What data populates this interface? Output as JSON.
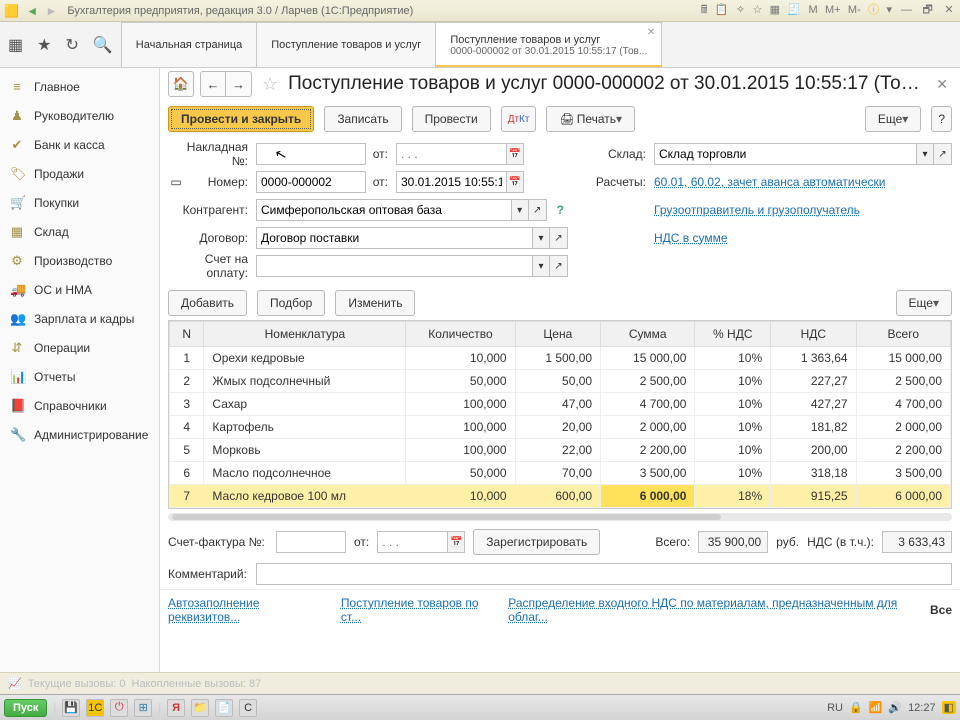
{
  "window": {
    "title": "Бухгалтерия предприятия, редакция 3.0 / Ларчев  (1С:Предприятие)"
  },
  "top_icons_right": [
    "📰",
    "⬚",
    "✧",
    "☆",
    "⊞",
    "⊡",
    "М",
    "М+",
    "М-",
    "ⓘ",
    "▾",
    "—",
    "🗗",
    "✕"
  ],
  "tabs": [
    {
      "l1": "Начальная страница"
    },
    {
      "l1": "Поступление товаров и услуг"
    },
    {
      "l1": "Поступление товаров и услуг",
      "l2": "0000-000002 от 30.01.2015 10:55:17 (Тов..."
    }
  ],
  "sidebar": [
    {
      "icon": "≡",
      "label": "Главное"
    },
    {
      "icon": "♟",
      "label": "Руководителю"
    },
    {
      "icon": "✔",
      "label": "Банк и касса"
    },
    {
      "icon": "🏷",
      "label": "Продажи"
    },
    {
      "icon": "🛒",
      "label": "Покупки"
    },
    {
      "icon": "▦",
      "label": "Склад"
    },
    {
      "icon": "⚙",
      "label": "Производство"
    },
    {
      "icon": "🚚",
      "label": "ОС и НМА"
    },
    {
      "icon": "👥",
      "label": "Зарплата и кадры"
    },
    {
      "icon": "⇵",
      "label": "Операции"
    },
    {
      "icon": "📊",
      "label": "Отчеты"
    },
    {
      "icon": "📕",
      "label": "Справочники"
    },
    {
      "icon": "🔧",
      "label": "Администрирование"
    }
  ],
  "doc": {
    "title": "Поступление товаров и услуг 0000-000002 от 30.01.2015 10:55:17 (Тов...",
    "btn_post_close": "Провести и закрыть",
    "btn_write": "Записать",
    "btn_post": "Провести",
    "btn_print": "Печать",
    "btn_more": "Еще",
    "labels": {
      "nakladnaya": "Накладная №:",
      "ot": "от:",
      "nomer": "Номер:",
      "kontragent": "Контрагент:",
      "dogovor": "Договор:",
      "schet_oplatu": "Счет на оплату:",
      "sklad": "Склад:",
      "raschety": "Расчеты:",
      "schet_faktura": "Счет-фактура №:",
      "kommentariy": "Комментарий:",
      "vsego": "Всего:",
      "rub": "руб.",
      "nds_vtch": "НДС (в т.ч.):"
    },
    "values": {
      "number": "0000-000002",
      "date": "30.01.2015 10:55:17",
      "kontragent": "Симферопольская оптовая база",
      "dogovor": "Договор поставки",
      "sklad": "Склад торговли",
      "raschety_link": "60.01, 60.02, зачет аванса автоматически",
      "gruz_link": "Грузоотправитель и грузополучатель",
      "nds_link": "НДС в сумме",
      "date_placeholder": ". . .",
      "total": "35 900,00",
      "nds_total": "3 633,43"
    },
    "btn_add": "Добавить",
    "btn_podbor": "Подбор",
    "btn_izmenit": "Изменить",
    "btn_register": "Зарегистрировать"
  },
  "grid": {
    "headers": [
      "N",
      "Номенклатура",
      "Количество",
      "Цена",
      "Сумма",
      "% НДС",
      "НДС",
      "Всего"
    ],
    "rows": [
      [
        "1",
        "Орехи кедровые",
        "10,000",
        "1 500,00",
        "15 000,00",
        "10%",
        "1 363,64",
        "15 000,00"
      ],
      [
        "2",
        "Жмых подсолнечный",
        "50,000",
        "50,00",
        "2 500,00",
        "10%",
        "227,27",
        "2 500,00"
      ],
      [
        "3",
        "Сахар",
        "100,000",
        "47,00",
        "4 700,00",
        "10%",
        "427,27",
        "4 700,00"
      ],
      [
        "4",
        "Картофель",
        "100,000",
        "20,00",
        "2 000,00",
        "10%",
        "181,82",
        "2 000,00"
      ],
      [
        "5",
        "Морковь",
        "100,000",
        "22,00",
        "2 200,00",
        "10%",
        "200,00",
        "2 200,00"
      ],
      [
        "6",
        "Масло подсолнечное",
        "50,000",
        "70,00",
        "3 500,00",
        "10%",
        "318,18",
        "3 500,00"
      ],
      [
        "7",
        "Масло кедровое 100 мл",
        "10,000",
        "600,00",
        "6 000,00",
        "18%",
        "915,25",
        "6 000,00"
      ]
    ]
  },
  "bottom_links": {
    "l1": "Автозаполнение реквизитов...",
    "l2": "Поступление товаров по ст...",
    "l3": "Распределение входного НДС по материалам, предназначенным для облаг...",
    "all": "Все"
  },
  "status1": {
    "t1": "Текущие вызовы: 0",
    "t2": "Накопленные вызовы: 87"
  },
  "taskbar": {
    "start": "Пуск",
    "lang": "RU",
    "time": "12:27"
  }
}
